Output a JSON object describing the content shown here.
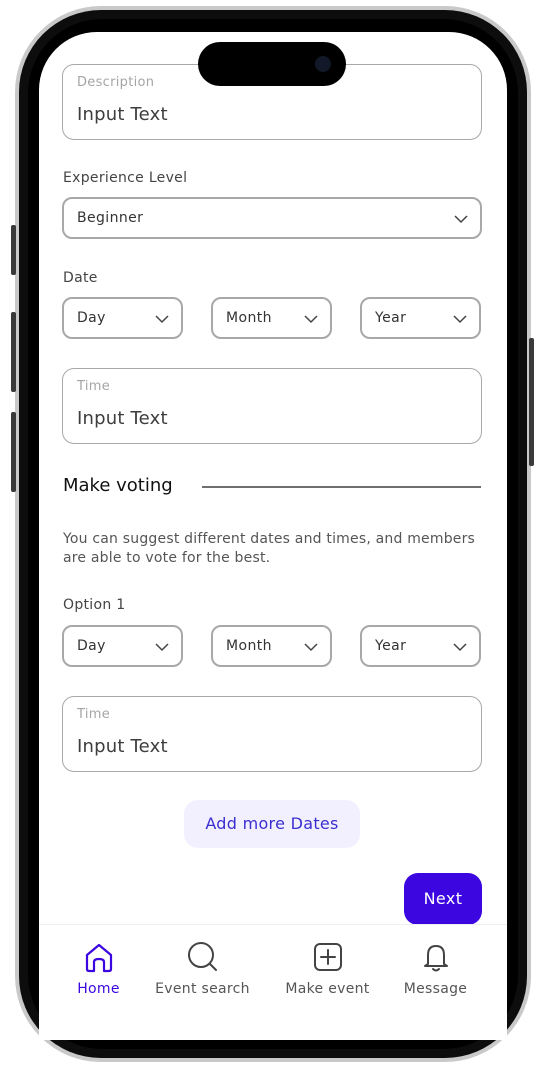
{
  "form": {
    "description": {
      "label": "Description",
      "value": "Input Text"
    },
    "experience": {
      "label": "Experience Level",
      "selected": "Beginner"
    },
    "date": {
      "label": "Date",
      "day": "Day",
      "month": "Month",
      "year": "Year"
    },
    "time": {
      "label": "Time",
      "value": "Input Text"
    }
  },
  "voting": {
    "heading": "Make voting",
    "description": "You can suggest different dates and times, and members are able to vote for the best.",
    "option1": {
      "label": "Option 1",
      "day": "Day",
      "month": "Month",
      "year": "Year"
    },
    "time": {
      "label": "Time",
      "value": "Input Text"
    },
    "add_more_label": "Add more Dates"
  },
  "actions": {
    "next_label": "Next"
  },
  "tabbar": {
    "items": [
      {
        "label": "Home",
        "icon": "home-icon",
        "active": true
      },
      {
        "label": "Event search",
        "icon": "search-icon",
        "active": false
      },
      {
        "label": "Make event",
        "icon": "plus-square-icon",
        "active": false
      },
      {
        "label": "Message",
        "icon": "bell-icon",
        "active": false
      }
    ]
  },
  "colors": {
    "accent": "#3b06e0",
    "accent_soft": "#f2f0ff",
    "border": "#a8a8a8"
  }
}
